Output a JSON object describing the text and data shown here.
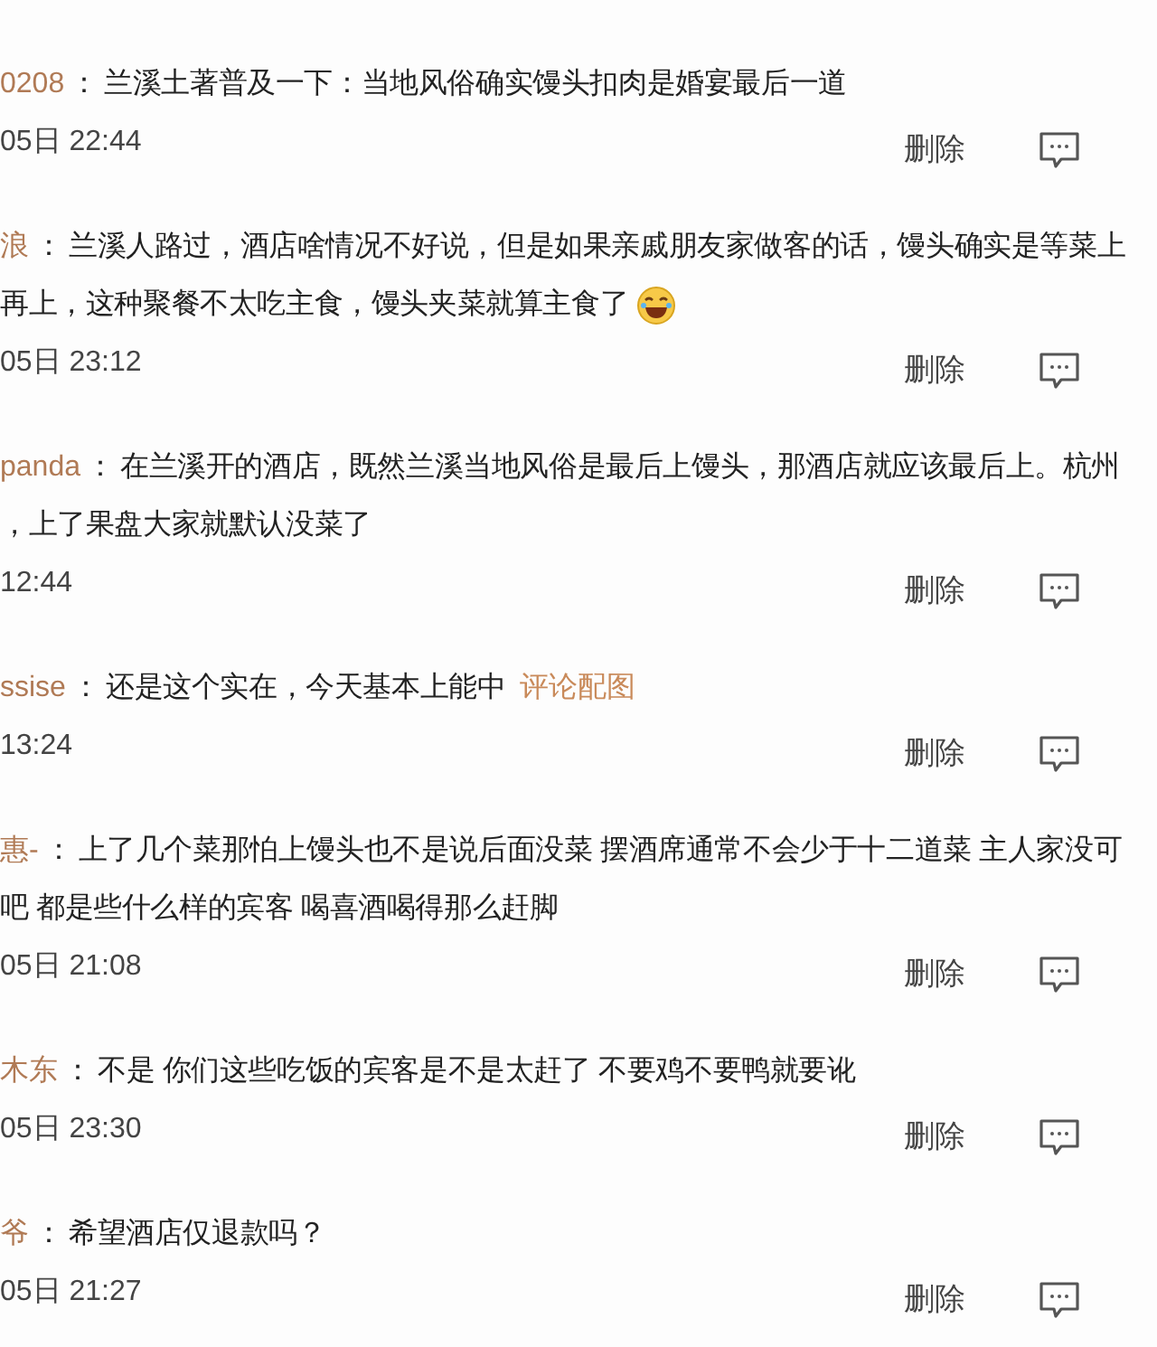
{
  "comments": [
    {
      "user": "0208",
      "sep": "：",
      "lines": [
        "兰溪土著普及一下：当地风俗确实馒头扣肉是婚宴最后一道"
      ],
      "time": "05日 22:44",
      "delete": "删除"
    },
    {
      "user": "浪",
      "sep": "：",
      "lines": [
        "兰溪人路过，酒店啥情况不好说，但是如果亲戚朋友家做客的话，馒头确实是等菜上",
        "再上，这种聚餐不太吃主食，馒头夹菜就算主食了"
      ],
      "emoji": true,
      "time": "05日 23:12",
      "delete": "删除"
    },
    {
      "user": "panda",
      "sep": "：",
      "lines": [
        "在兰溪开的酒店，既然兰溪当地风俗是最后上馒头，那酒店就应该最后上。杭州",
        "，上了果盘大家就默认没菜了"
      ],
      "time": "12:44",
      "delete": "删除"
    },
    {
      "user": "ssise",
      "sep": "：",
      "lines": [
        "还是这个实在，今天基本上能中"
      ],
      "link": "评论配图",
      "time": "13:24",
      "delete": "删除"
    },
    {
      "user": "惠-",
      "sep": "：",
      "lines": [
        "上了几个菜那怕上馒头也不是说后面没菜 摆酒席通常不会少于十二道菜 主人家没可",
        "吧 都是些什么样的宾客 喝喜酒喝得那么赶脚"
      ],
      "time": "05日 21:08",
      "delete": "删除"
    },
    {
      "user": "木东",
      "sep": "：",
      "lines": [
        "不是 你们这些吃饭的宾客是不是太赶了 不要鸡不要鸭就要讹"
      ],
      "time": "05日 23:30",
      "delete": "删除"
    },
    {
      "user": "爷",
      "sep": "：",
      "lines": [
        "希望酒店仅退款吗？"
      ],
      "time": "05日 21:27",
      "delete": "删除"
    }
  ]
}
